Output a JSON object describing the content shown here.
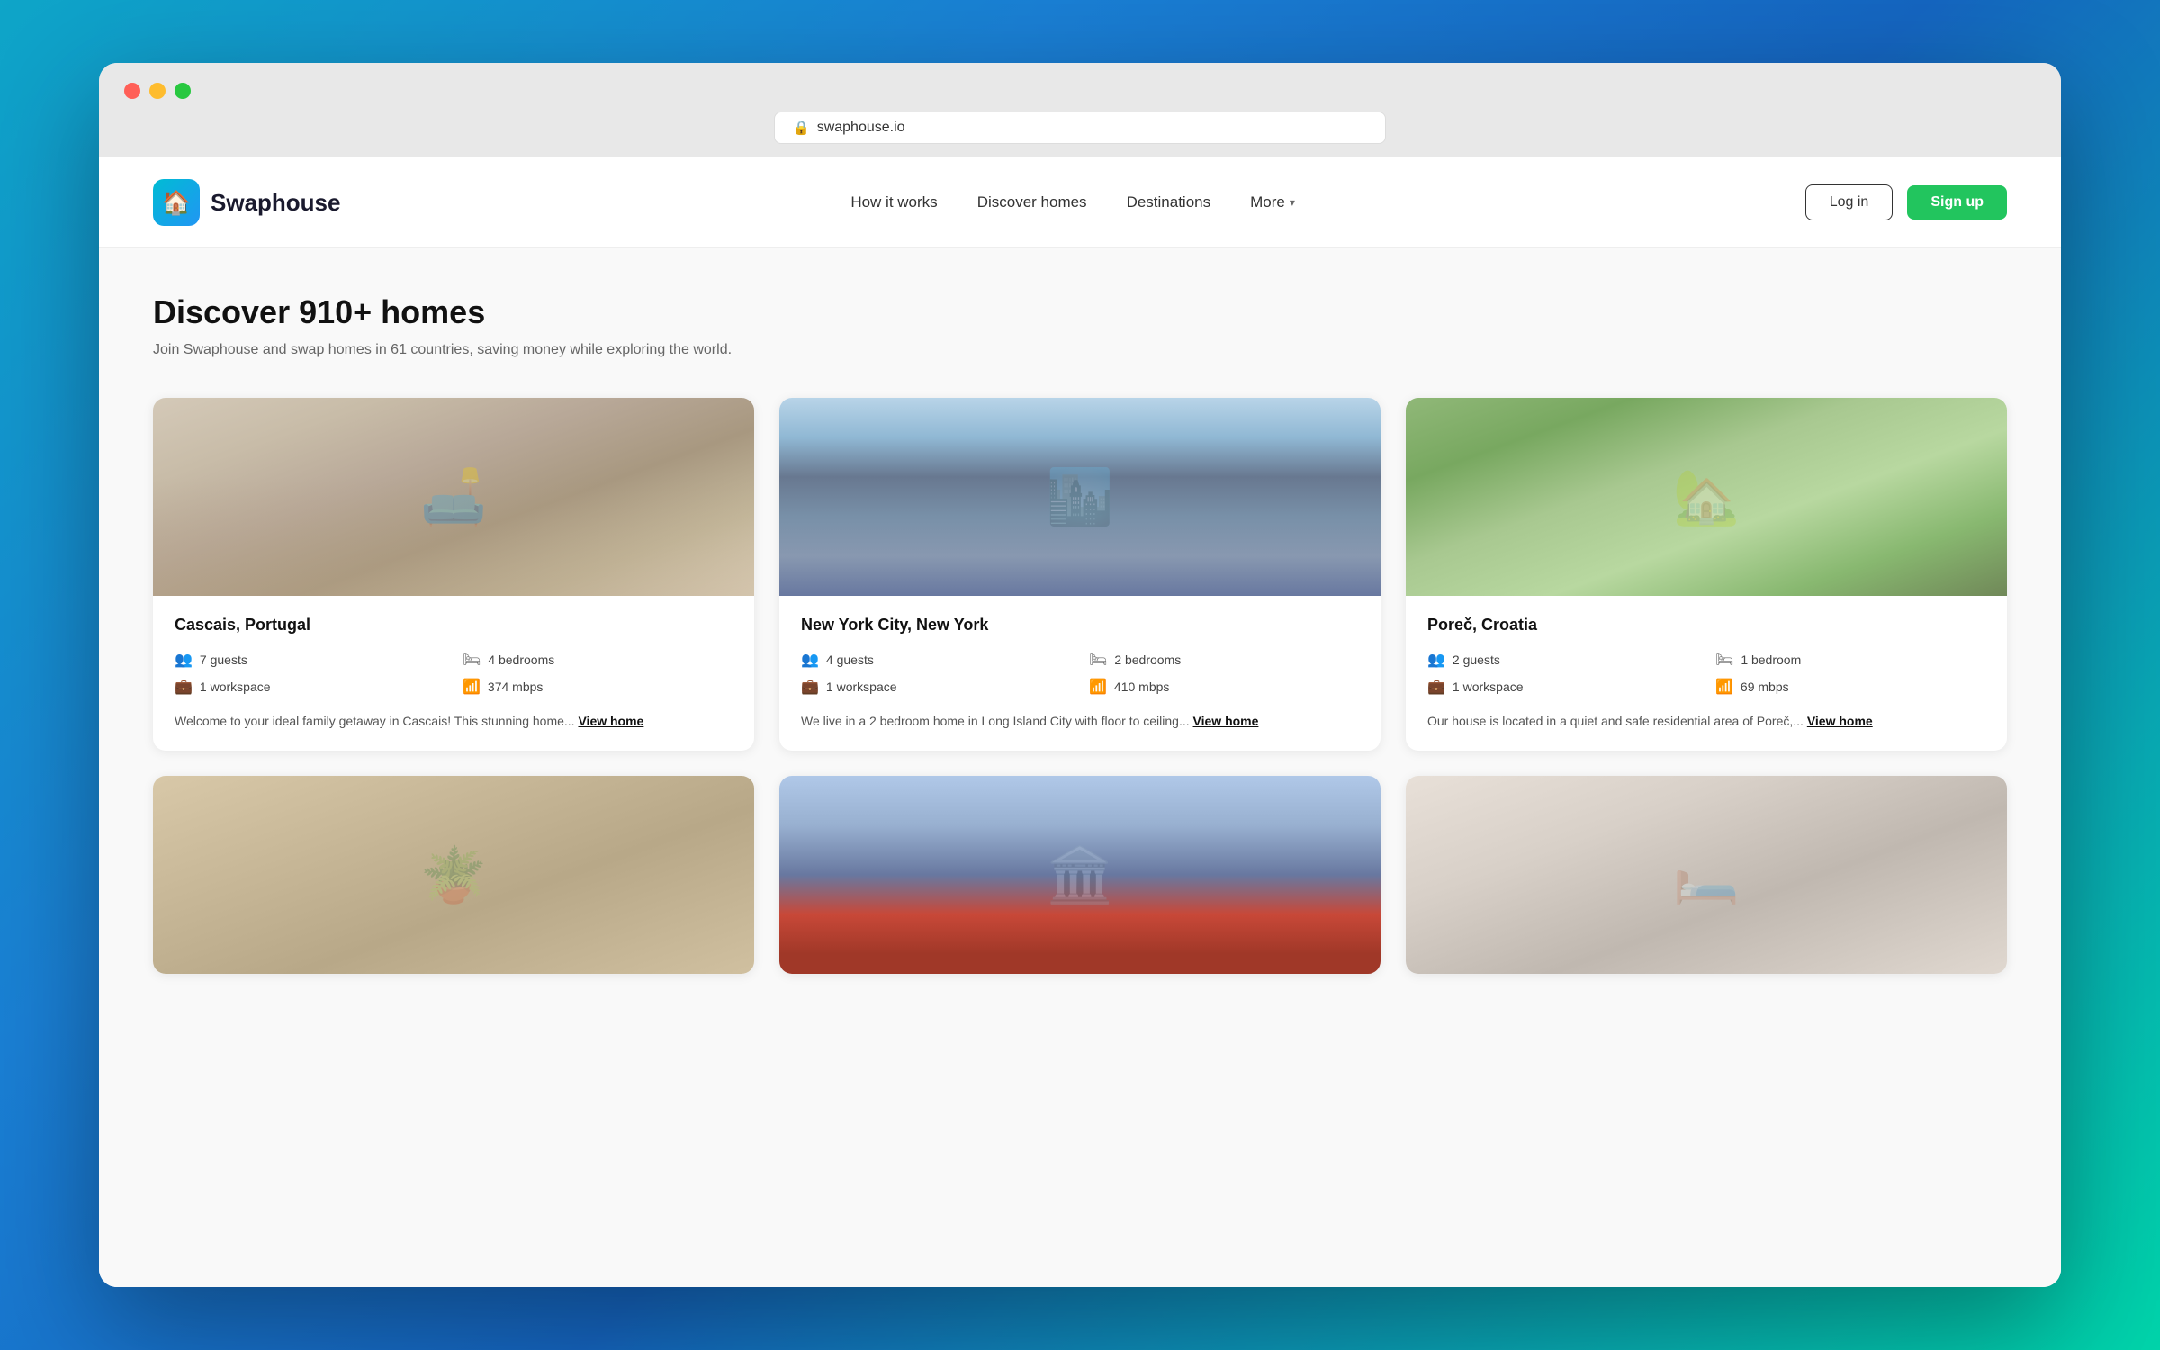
{
  "browser": {
    "url": "swaphouse.io"
  },
  "navbar": {
    "brand": "Swaphouse",
    "links": [
      {
        "id": "how-it-works",
        "label": "How it works"
      },
      {
        "id": "discover-homes",
        "label": "Discover homes"
      },
      {
        "id": "destinations",
        "label": "Destinations"
      },
      {
        "id": "more",
        "label": "More"
      }
    ],
    "login_label": "Log in",
    "signup_label": "Sign up"
  },
  "main": {
    "heading": "Discover 910+ homes",
    "subheading": "Join Swaphouse and swap homes in 61 countries, saving money while exploring the world."
  },
  "homes": [
    {
      "id": "cascais",
      "location": "Cascais, Portugal",
      "guests": "7 guests",
      "bedrooms": "4 bedrooms",
      "workspace": "1 workspace",
      "mbps": "374 mbps",
      "description": "Welcome to your ideal family getaway in Cascais! This stunning home...",
      "view_link": "View home"
    },
    {
      "id": "nyc",
      "location": "New York City, New York",
      "guests": "4 guests",
      "bedrooms": "2 bedrooms",
      "workspace": "1 workspace",
      "mbps": "410 mbps",
      "description": "We live in a 2 bedroom home in Long Island City with floor to ceiling...",
      "view_link": "View home"
    },
    {
      "id": "porec",
      "location": "Poreč, Croatia",
      "guests": "2 guests",
      "bedrooms": "1 bedroom",
      "workspace": "1 workspace",
      "mbps": "69 mbps",
      "description": "Our house is located in a quiet and safe residential area of Poreč,...",
      "view_link": "View home"
    },
    {
      "id": "room1",
      "location": "",
      "guests": "",
      "bedrooms": "",
      "workspace": "",
      "mbps": "",
      "description": "",
      "view_link": ""
    },
    {
      "id": "city2",
      "location": "",
      "guests": "",
      "bedrooms": "",
      "workspace": "",
      "mbps": "",
      "description": "",
      "view_link": ""
    },
    {
      "id": "room2",
      "location": "",
      "guests": "",
      "bedrooms": "",
      "workspace": "",
      "mbps": "",
      "description": "",
      "view_link": ""
    }
  ],
  "icons": {
    "lock": "🔒",
    "guests": "👥",
    "bedrooms": "🛏",
    "workspace": "💼",
    "wifi": "📶",
    "chevron": "▾",
    "house": "🏠"
  },
  "colors": {
    "brand_green": "#22c55e",
    "brand_teal": "#00bcd4",
    "brand_blue": "#2196f3"
  }
}
